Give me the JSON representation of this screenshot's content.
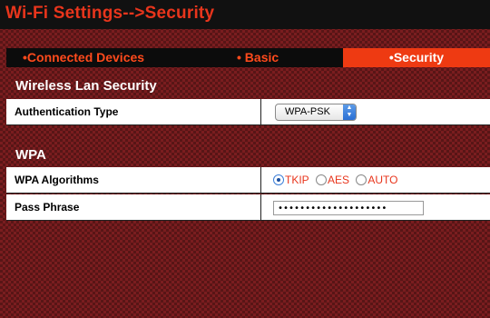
{
  "header": {
    "title": "Wi-Fi Settings-->Security"
  },
  "tabs": [
    {
      "label": "•Connected Devices",
      "active": false
    },
    {
      "label": "• Basic",
      "active": false
    },
    {
      "label": "•Security",
      "active": true
    }
  ],
  "wireless_lan_security": {
    "heading": "Wireless Lan Security",
    "auth_type_label": "Authentication Type",
    "auth_type_value": "WPA-PSK"
  },
  "wpa": {
    "heading": "WPA",
    "algorithms_label": "WPA Algorithms",
    "algorithms": [
      {
        "label": "TKIP",
        "checked": true
      },
      {
        "label": "AES",
        "checked": false
      },
      {
        "label": "AUTO",
        "checked": false
      }
    ],
    "pass_phrase_label": "Pass Phrase",
    "pass_phrase_value": "••••••••••••••••••••"
  },
  "colors": {
    "accent": "#e8351c",
    "active_tab": "#ee3a12",
    "background": "#7a1d1f",
    "bar": "#111111"
  }
}
